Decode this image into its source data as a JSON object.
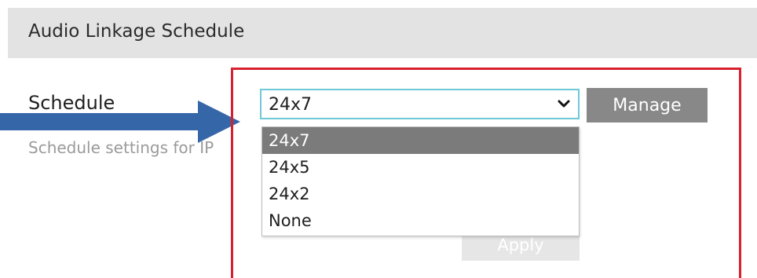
{
  "header": {
    "title": "Audio Linkage Schedule"
  },
  "schedule": {
    "label": "Schedule",
    "description": "Schedule settings for IP"
  },
  "select": {
    "value": "24x7",
    "options": [
      {
        "label": "24x7",
        "selected": true
      },
      {
        "label": "24x5",
        "selected": false
      },
      {
        "label": "24x2",
        "selected": false
      },
      {
        "label": "None",
        "selected": false
      }
    ]
  },
  "manage_button": {
    "label": "Manage"
  },
  "apply_button": {
    "label": "Apply"
  },
  "colors": {
    "highlight_border": "#d8212e",
    "arrow": "#3566a8",
    "select_border": "#6ec9d6",
    "selected_option_bg": "#7b7b7b",
    "manage_bg": "#888888",
    "header_bg": "#e3e3e3"
  },
  "icons": {
    "select_chevron": "chevron-down-icon",
    "pointer_arrow": "arrow-right-icon"
  }
}
